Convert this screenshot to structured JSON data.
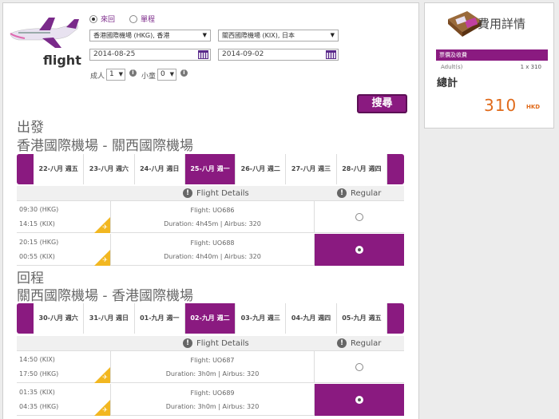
{
  "brand": {
    "text": "flight"
  },
  "trip_type": {
    "round": "來回",
    "oneway": "單程"
  },
  "search": {
    "origin": "香港國際機場 (HKG), 香港",
    "destination": "關西國際機場 (KIX), 日本",
    "depart_date": "2014-08-25",
    "return_date": "2014-09-02",
    "adult_label": "成人",
    "adult_value": "1",
    "child_label": "小童",
    "child_value": "0",
    "button": "搜尋"
  },
  "outbound": {
    "section": "出發",
    "route": "香港國際機場 - 關西國際機場",
    "dates": [
      "22-八月 週五",
      "23-八月 週六",
      "24-八月 週日",
      "25-八月 週一",
      "26-八月 週二",
      "27-八月 週三",
      "28-八月 週四"
    ],
    "selected_index": 3,
    "header": {
      "details": "Flight Details",
      "fare": "Regular"
    },
    "flights": [
      {
        "dep": "09:30 (HKG)",
        "arr": "14:15 (KIX)",
        "flight": "Flight: UO686",
        "duration": "Duration: 4h45m | Airbus: 320",
        "selected": false
      },
      {
        "dep": "20:15 (HKG)",
        "arr": "00:55 (KIX)",
        "flight": "Flight: UO688",
        "duration": "Duration: 4h40m | Airbus: 320",
        "selected": true
      }
    ]
  },
  "inbound": {
    "section": "回程",
    "route": "關西國際機場 - 香港國際機場",
    "dates": [
      "30-八月 週六",
      "31-八月 週日",
      "01-九月 週一",
      "02-九月 週二",
      "03-九月 週三",
      "04-九月 週四",
      "05-九月 週五"
    ],
    "selected_index": 3,
    "header": {
      "details": "Flight Details",
      "fare": "Regular"
    },
    "flights": [
      {
        "dep": "14:50 (KIX)",
        "arr": "17:50 (HKG)",
        "flight": "Flight: UO687",
        "duration": "Duration: 3h0m | Airbus: 320",
        "selected": false
      },
      {
        "dep": "01:35 (KIX)",
        "arr": "04:35 (HKG)",
        "flight": "Flight: UO689",
        "duration": "Duration: 3h0m | Airbus: 320",
        "selected": true
      }
    ]
  },
  "summary": {
    "title": "費用詳情",
    "fee_header": "票價及收費",
    "adult_label": "Adult(s)",
    "adult_value": "1 x 310",
    "total_label": "總計",
    "total_value": "310",
    "currency": "HKD"
  },
  "colors": {
    "brand": "#8a1a80",
    "accent": "#f2b720",
    "price": "#e06a1a"
  }
}
